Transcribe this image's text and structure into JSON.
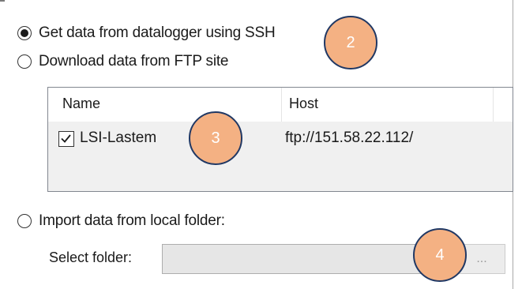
{
  "options": {
    "ssh": {
      "label": "Get data from datalogger using SSH",
      "selected": true
    },
    "ftp": {
      "label": "Download data from FTP site",
      "selected": false
    },
    "local": {
      "label": "Import data from local folder:",
      "selected": false
    }
  },
  "ftp_list": {
    "columns": [
      "Name",
      "Host"
    ],
    "rows": [
      {
        "checked": true,
        "name": "LSI-Lastem",
        "host": "ftp://151.58.22.112/"
      }
    ]
  },
  "folder": {
    "label": "Select folder:",
    "value": "",
    "browse_label": "..."
  },
  "callouts": [
    "2",
    "3",
    "4"
  ],
  "colors": {
    "callout_fill": "#f4b183",
    "callout_border": "#203864",
    "list_background": "#f0f0f0"
  }
}
